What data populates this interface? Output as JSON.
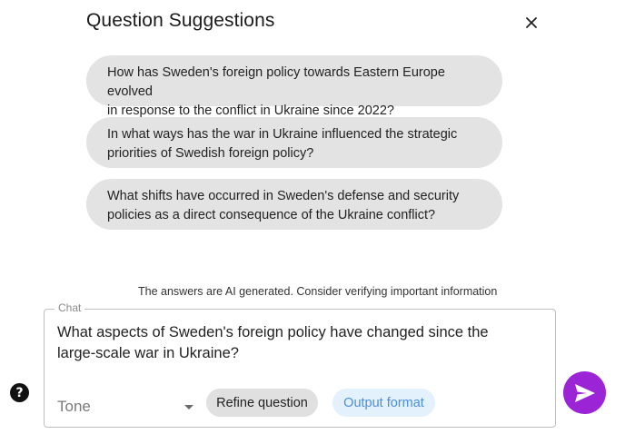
{
  "header": {
    "title": "Question Suggestions"
  },
  "suggestions": [
    {
      "line1": "How has Sweden's foreign policy towards Eastern Europe evolved",
      "line2": "in response to the conflict in Ukraine since 2022?"
    },
    {
      "line1": "In what ways has the war in Ukraine influenced the strategic",
      "line2": "priorities of Swedish foreign policy?"
    },
    {
      "line1": "What shifts have occurred in Sweden's defense and security",
      "line2": "policies as a direct consequence of the Ukraine conflict?"
    }
  ],
  "disclaimer": "The answers are AI generated. Consider verifying important information",
  "chat": {
    "legend": "Chat",
    "line1": "What aspects of Sweden's foreign policy have changed since the",
    "line2": "large-scale war in Ukraine?",
    "tone_placeholder": "Tone",
    "refine_label": "Refine question",
    "format_label": "Output format"
  },
  "icons": {
    "close": "close-icon",
    "help": "question-mark-icon",
    "send": "send-icon",
    "dropdown": "chevron-down-icon"
  },
  "colors": {
    "send_button": "#9a24d6",
    "format_chip_bg": "#e3f1fd",
    "format_chip_text": "#4a8fd8",
    "suggestion_bg": "#e3e3e3"
  }
}
